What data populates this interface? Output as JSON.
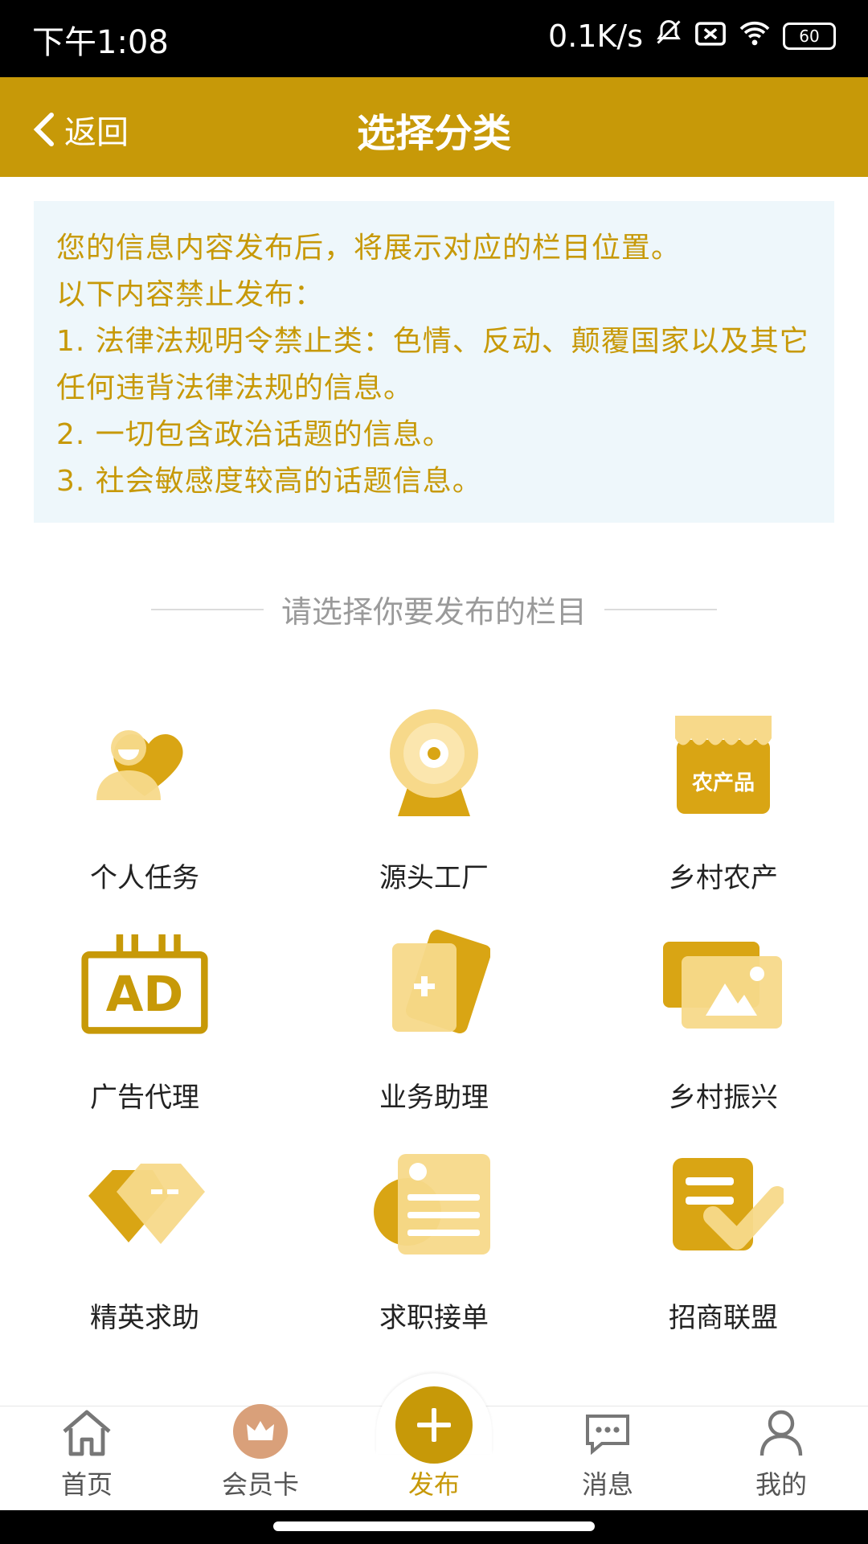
{
  "status": {
    "time": "下午1:08",
    "speed": "0.1K/s",
    "battery": "60"
  },
  "nav": {
    "back_label": "返回",
    "title": "选择分类"
  },
  "notice": {
    "lines": [
      "您的信息内容发布后，将展示对应的栏目位置。",
      "以下内容禁止发布：",
      "1.  法律法规明令禁止类：色情、反动、颠覆国家以及其它任何违背法律法规的信息。",
      "2.  一切包含政治话题的信息。",
      "3.  社会敏感度较高的话题信息。"
    ]
  },
  "section_title": "请选择你要发布的栏目",
  "categories": [
    {
      "label": "个人任务",
      "icon": "person-heart-icon"
    },
    {
      "label": "源头工厂",
      "icon": "webcam-icon"
    },
    {
      "label": "乡村农产",
      "icon": "market-stall-icon",
      "badge": "农产品"
    },
    {
      "label": "广告代理",
      "icon": "ad-board-icon",
      "badge": "AD"
    },
    {
      "label": "业务助理",
      "icon": "cards-plus-icon"
    },
    {
      "label": "乡村振兴",
      "icon": "landscape-photo-icon"
    },
    {
      "label": "精英求助",
      "icon": "diamond-icon"
    },
    {
      "label": "求职接单",
      "icon": "resume-icon"
    },
    {
      "label": "招商联盟",
      "icon": "document-check-icon"
    }
  ],
  "tabbar": {
    "items": [
      {
        "label": "首页",
        "icon": "home-icon"
      },
      {
        "label": "会员卡",
        "icon": "crown-icon"
      },
      {
        "label": "发布",
        "icon": "plus-icon"
      },
      {
        "label": "消息",
        "icon": "chat-icon"
      },
      {
        "label": "我的",
        "icon": "user-icon"
      }
    ]
  },
  "colors": {
    "accent": "#C79908",
    "light_accent": "#F5D27A",
    "notice_bg": "#EEF7FB"
  }
}
